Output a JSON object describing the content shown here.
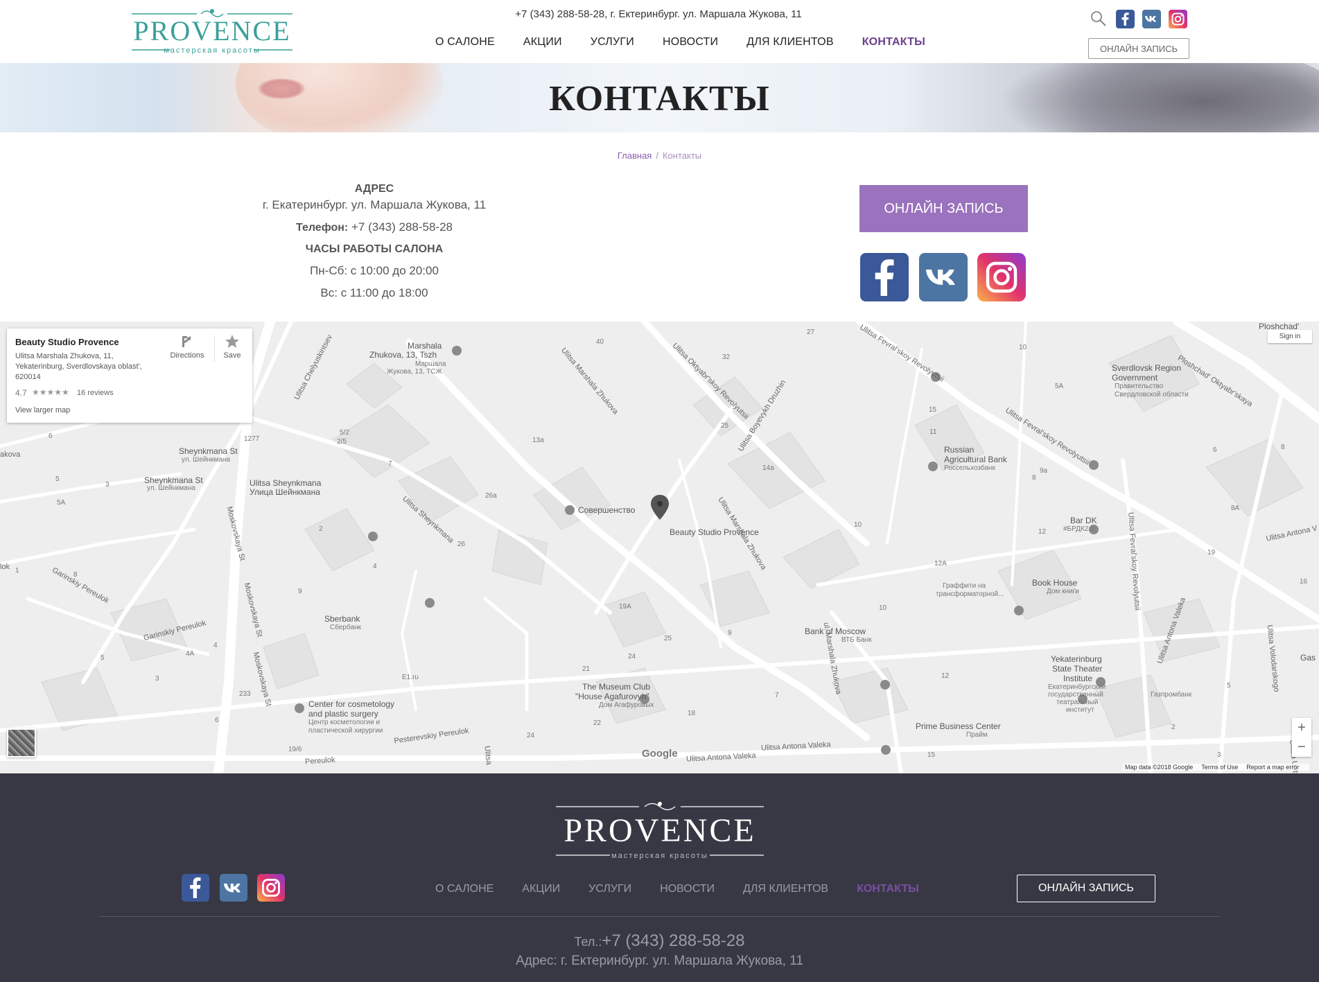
{
  "header": {
    "logo_text": "PROVENCE",
    "logo_subtitle": "мастерская красоты",
    "top_text": "+7 (343) 288-58-28, г. Ектеринбург. ул. Маршала Жукова, 11",
    "nav": [
      "О САЛОНЕ",
      "АКЦИИ",
      "УСЛУГИ",
      "НОВОСТИ",
      "ДЛЯ КЛИЕНТОВ",
      "КОНТАКТЫ"
    ],
    "active_nav": "КОНТАКТЫ",
    "cta": "ОНЛАЙН ЗАПИСЬ",
    "icons": [
      "search-icon",
      "facebook-icon",
      "vk-icon",
      "instagram-icon"
    ]
  },
  "banner": {
    "title": "КОНТАКТЫ"
  },
  "breadcrumb": {
    "home": "Главная",
    "separator": "/",
    "current": "Контакты"
  },
  "contact": {
    "address_label": "АДРЕС",
    "address": "г. Екатеринбург. ул. Маршала Жукова, 11",
    "phone_label": "Телефон:",
    "phone": "+7 (343) 288-58-28",
    "hours_label": "ЧАСЫ РАБОТЫ САЛОНА",
    "hours_weekdays": "Пн-Сб: с 10:00 до 20:00",
    "hours_sunday": "Вс: с 11:00 до 18:00",
    "cta": "ОНЛАЙН ЗАПИСЬ"
  },
  "map": {
    "card": {
      "name": "Beauty Studio Provence",
      "address": "Ulitsa Marshala Zhukova, 11, Yekaterinburg, Sverdlovskaya oblast', 620014",
      "rating": "4.7",
      "stars": "★★★★★",
      "reviews": "16 reviews",
      "larger_map": "View larger map",
      "directions": "Directions",
      "save": "Save"
    },
    "sign_in": "Sign in",
    "zoom_in": "+",
    "zoom_out": "−",
    "google": "Google",
    "attribution": [
      "Map data ©2018 Google",
      "Terms of Use",
      "Report a map error"
    ],
    "labels": {
      "marker": "Beauty Studio Provence",
      "sovershenstvo": "Совершенство",
      "marshala_1": "Marshala",
      "marshala_2": "Zhukova, 13, Tszh",
      "marshala_3": "Маршала",
      "marshala_4": "Жукова, 13, ТСЖ",
      "sheynkmana_st_1": "Sheynkmana St",
      "sheynkmana_st_2": "ул. Шейнкмана",
      "sheynkmana_st_3": "Sheynkmana St",
      "sheynkmana_st_4": "ул. Шейнкмана",
      "ulitsa_sheynkmana_1": "Ulitsa Sheynkmana",
      "ulitsa_sheynkmana_2": "Улица Шейнкмана",
      "sverdlovsk_1": "Sverdlovsk Region",
      "sverdlovsk_2": "Government",
      "sverdlovsk_3": "Правительство",
      "sverdlovsk_4": "Свердловской области",
      "rab_1": "Russian",
      "rab_2": "Agricultural Bank",
      "rab_3": "Россельхозбанк",
      "bar_dk_1": "Bar DK",
      "bar_dk_2": "#БРДК2.0",
      "graffiti_1": "Граффити на",
      "graffiti_2": "трансформаторной...",
      "book_house_1": "Book House",
      "book_house_2": "Дом книги",
      "bank_moscow_1": "Bank of Moscow",
      "bank_moscow_2": "ВТБ Банк",
      "sberbank_1": "Sberbank",
      "sberbank_2": "Сбербанк",
      "e1": "E1.ru",
      "museum_1": "The Museum Club",
      "museum_2": "\"House Agafurovyh\"",
      "museum_3": "Дом Агафуровых",
      "cosmetology_1": "Center for cosmetology",
      "cosmetology_2": "and plastic surgery",
      "cosmetology_3": "Центр косметологии и",
      "cosmetology_4": "пластической хирургии",
      "theater_1": "Yekaterinburg",
      "theater_2": "State Theater",
      "theater_3": "Institute",
      "theater_4": "Екатеринбургский",
      "theater_5": "государственный",
      "theater_6": "театральный",
      "theater_7": "институт",
      "prime_1": "Prime Business Center",
      "prime_2": "Прайм",
      "gazprombank": "Газпромбанк",
      "ploshchad": "Ploshchad'",
      "ploshchad_oktyabr": "Ploshchad' Oktyabr'skaya",
      "gas": "Gas",
      "st_chelyuskintsev": "Ulitsa Chelyuskintsev",
      "st_moskovskaya_1": "Moskovskaya St",
      "st_moskovskaya_2": "Moskovskaya St",
      "st_marshala_1": "Ulitsa Marshala Zhukova",
      "st_marshala_2": "Ulitsa Marshala Zhukova",
      "st_marshala_3": "ul. Marshala Zhukova",
      "st_oktyabr": "Ulitsa Oktyabr'skoy Revolyutsii",
      "st_boyevykh": "Ulitsa Boyevykh Druzhin",
      "st_fevral_1": "Ulitsa Fevral'skoy Revolyutsii",
      "st_fevral_2": "Ulitsa Fevral'skoy Revolyutsii",
      "st_fevral_3": "Ulitsa Fevral'skoy Revolyutsii",
      "st_sheynkmana_diag": "Ulitsa Sheynkmana",
      "st_garinskiy_1": "Garinskiy Pereulok",
      "st_garinskiy_2": "Garinskiy Pereulok",
      "st_pesterevskiy": "Pesterevskiy Pereulok",
      "st_pereulok": "Pereulok",
      "st_antona_1": "Ulitsa Antona Valeka",
      "st_antona_2": "Ulitsa Antona Valeka",
      "st_antona_3": "Ulitsa Antona Valeka",
      "st_antona_4": "Ulitsa Antona V",
      "st_volodarskogo": "Ulitsa Volodarskogo",
      "st_unts": "Ulitsa Unts",
      "st_akova": "akova",
      "st_lok": "lok",
      "st_ulitsa": "Ulitsa"
    },
    "numbers": [
      "40",
      "27",
      "10",
      "32",
      "5A",
      "15",
      "25",
      "11",
      "13a",
      "5/2",
      "2/5",
      "7",
      "14a",
      "9a",
      "8",
      "1277",
      "6",
      "5",
      "5A",
      "3",
      "26a",
      "2",
      "26",
      "10",
      "12",
      "8A",
      "12A",
      "4",
      "1",
      "9",
      "19A",
      "8",
      "10",
      "24",
      "25",
      "9",
      "21",
      "12",
      "7",
      "5",
      "4A",
      "3",
      "4",
      "233",
      "18",
      "22",
      "24",
      "19/6",
      "15",
      "6",
      "5",
      "2",
      "16",
      "19",
      "8",
      "6",
      "4",
      "3"
    ]
  },
  "footer": {
    "logo_text": "PROVENCE",
    "logo_subtitle": "мастерская красоты",
    "nav": [
      "О САЛОНЕ",
      "АКЦИИ",
      "УСЛУГИ",
      "НОВОСТИ",
      "ДЛЯ КЛИЕНТОВ",
      "КОНТАКТЫ"
    ],
    "cta": "ОНЛАЙН ЗАПИСЬ",
    "phone_label": "Тел.:",
    "phone": "+7 (343) 288-58-28",
    "address": "Адрес: г. Ектеринбург. ул. Маршала Жукова, 11"
  },
  "colors": {
    "accent": "#9b72bd",
    "active_nav": "#6a3f8c",
    "logo_teal": "#3aa09a",
    "footer_bg": "#373844",
    "facebook": "#3b5998",
    "vk": "#4c75a3"
  }
}
